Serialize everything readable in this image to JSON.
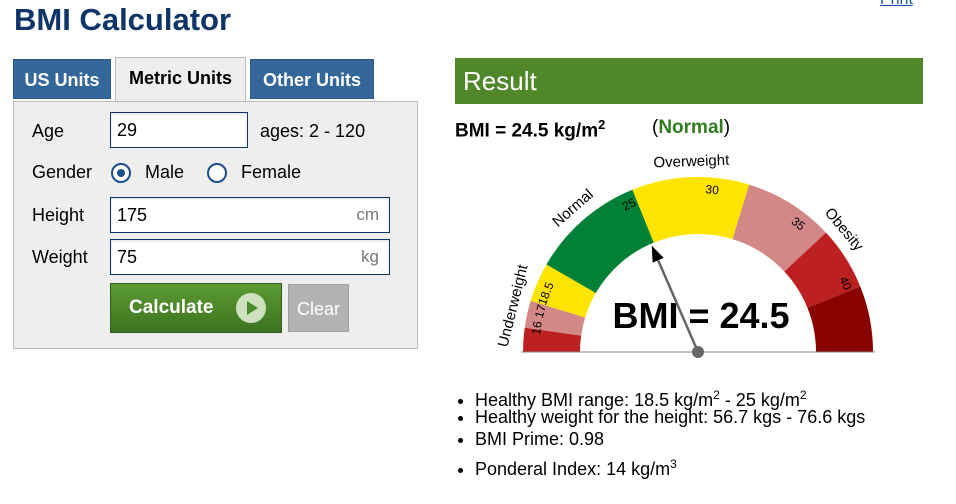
{
  "page": {
    "title": "BMI Calculator",
    "print_link": "Print"
  },
  "tabs": [
    {
      "label": "US Units",
      "active": false
    },
    {
      "label": "Metric Units",
      "active": true
    },
    {
      "label": "Other Units",
      "active": false
    }
  ],
  "form": {
    "age_label": "Age",
    "age_value": "29",
    "age_hint": "ages: 2 - 120",
    "gender_label": "Gender",
    "gender_male": "Male",
    "gender_female": "Female",
    "gender_selected": "Male",
    "height_label": "Height",
    "height_value": "175",
    "height_unit": "cm",
    "weight_label": "Weight",
    "weight_value": "75",
    "weight_unit": "kg",
    "calculate_label": "Calculate",
    "clear_label": "Clear"
  },
  "result": {
    "header": "Result",
    "bmi_prefix": "BMI = 24.5 kg/m",
    "bmi_exp": "2",
    "category": "Normal",
    "gauge": {
      "value": 24.5,
      "display": "BMI = 24.5",
      "category_labels": [
        "Underweight",
        "Normal",
        "Overweight",
        "Obesity"
      ],
      "tick_labels": [
        "16",
        "17",
        "18.5",
        "25",
        "30",
        "35",
        "40"
      ],
      "colors": {
        "severe_thin": "#bc2020",
        "moderate_thin": "#d38888",
        "mild_thin": "#ffe400",
        "normal": "#008137",
        "overweight": "#ffe400",
        "obese1": "#d38888",
        "obese2": "#bc2020",
        "obese3": "#8a0101"
      }
    },
    "details": {
      "healthy_range_a": "Healthy BMI range: 18.5 kg/m",
      "healthy_range_b": " - 25 kg/m",
      "exp": "2",
      "healthy_weight": "Healthy weight for the height: 56.7 kgs - 76.6 kgs",
      "bmi_prime": "BMI Prime: 0.98",
      "ponderal_a": "Ponderal Index: 14 kg/m",
      "ponderal_exp": "3"
    }
  }
}
